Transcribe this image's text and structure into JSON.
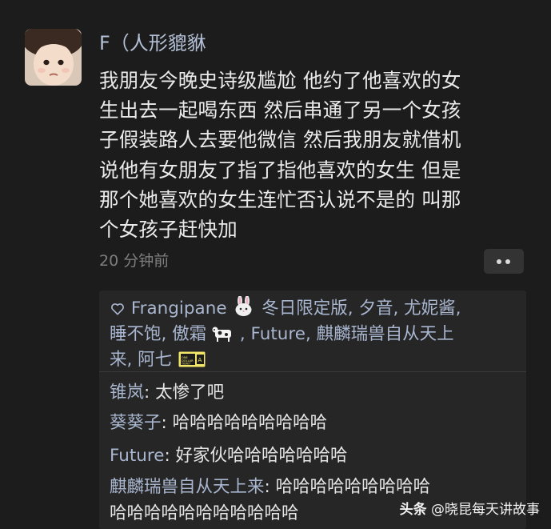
{
  "post": {
    "author": "F（人形貔貅",
    "content_lines": [
      "我朋友今晚史诗级尴尬 他约了他喜欢的女",
      "生出去一起喝东西 然后串通了另一个女孩",
      "子假装路人去要他微信 然后我朋友就借机",
      "说他有女朋友了指了指他喜欢的女生 但是",
      "那个她喜欢的女生连忙否认说不是的 叫那",
      "个女孩子赶快加"
    ],
    "time": "20 分钟前"
  },
  "likes": {
    "heart_icon": "heart-outline-icon",
    "line1_names": "Frangipane",
    "line1_rest": "冬日限定版, 夕音, 尤妮酱,",
    "line2_pre": "睡不饱, 傲霜",
    "line2_post": ", Future, 麒麟瑞兽自从天上",
    "line3": "来, 阿七",
    "ticket_text": "ONE DOLLAR TICKET"
  },
  "comments": [
    {
      "name": "锥岚",
      "sep": ": ",
      "text": "太惨了吧"
    },
    {
      "name": "葵葵子",
      "sep": ": ",
      "text": "哈哈哈哈哈哈哈哈哈"
    },
    {
      "name": "Future",
      "sep": ": ",
      "text": "好家伙哈哈哈哈哈哈哈"
    },
    {
      "name": "麒麟瑞兽自从天上来",
      "sep": ": ",
      "text": "哈哈哈哈哈哈哈哈哈",
      "text2": "哈哈哈哈哈哈哈哈哈哈哈"
    }
  ],
  "watermark": {
    "brand": "头条",
    "handle": "@晓昆每天讲故事"
  },
  "colors": {
    "background": "#1c1c1c",
    "panel": "#262626",
    "name_blue": "#a9b6cf",
    "text": "#eaeaea",
    "muted": "#7e7e7e"
  }
}
